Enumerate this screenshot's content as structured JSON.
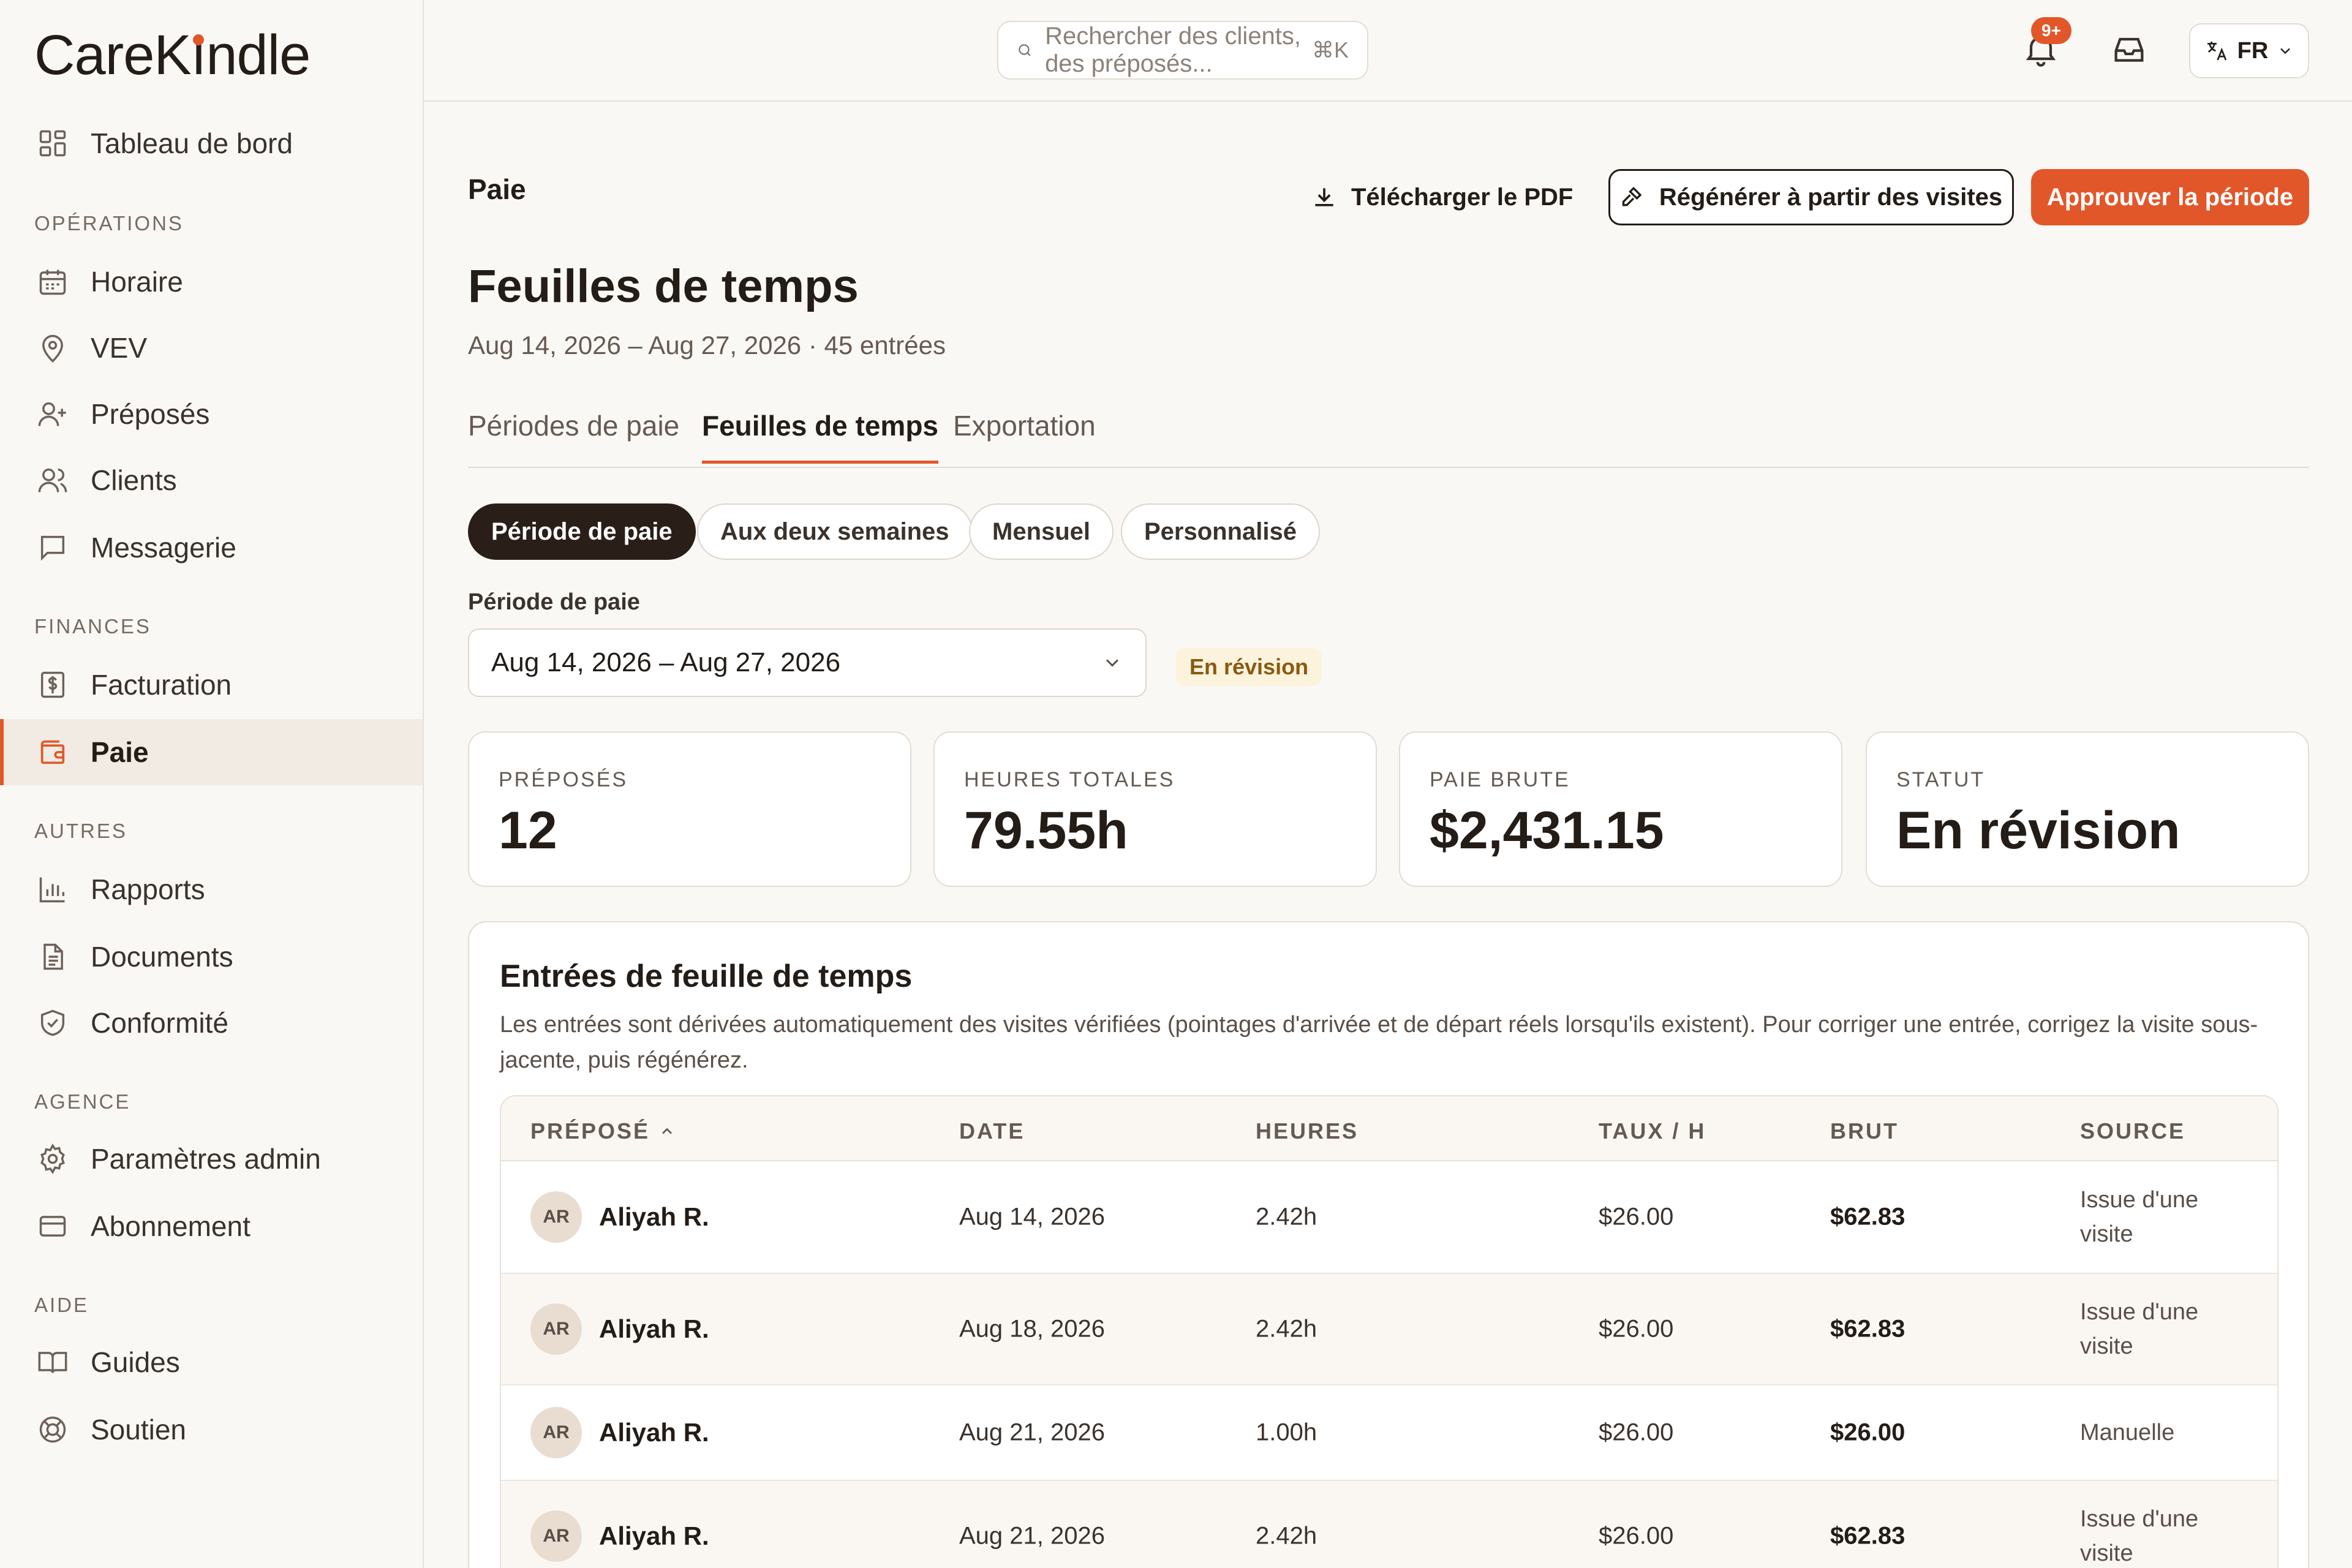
{
  "app": {
    "logo_text_before": "CareK",
    "logo_text_i": "ı",
    "logo_text_after": "ndle",
    "accent_color": "#e2572a"
  },
  "sidebar": {
    "dashboard": "Tableau de bord",
    "sections": {
      "operations": "OPÉRATIONS",
      "finances": "FINANCES",
      "autres": "AUTRES",
      "agence": "AGENCE",
      "aide": "AIDE"
    },
    "items": {
      "horaire": "Horaire",
      "vev": "VEV",
      "preposes": "Préposés",
      "clients": "Clients",
      "messagerie": "Messagerie",
      "facturation": "Facturation",
      "paie": "Paie",
      "rapports": "Rapports",
      "documents": "Documents",
      "conformite": "Conformité",
      "parametres": "Paramètres admin",
      "abonnement": "Abonnement",
      "guides": "Guides",
      "soutien": "Soutien"
    }
  },
  "topbar": {
    "search_placeholder": "Rechercher des clients, des préposés...",
    "search_shortcut": "⌘K",
    "notification_count": "9+",
    "language": "FR"
  },
  "header": {
    "breadcrumb": "Paie",
    "download_label": "Télécharger le PDF",
    "regenerate_label": "Régénérer à partir des visites",
    "approve_label": "Approuver la période",
    "title": "Feuilles de temps",
    "subtitle": "Aug 14, 2026 – Aug 27, 2026 · 45 entrées"
  },
  "tabs": [
    "Périodes de paie",
    "Feuilles de temps",
    "Exportation"
  ],
  "filters": [
    "Période de paie",
    "Aux deux semaines",
    "Mensuel",
    "Personnalisé"
  ],
  "period": {
    "label": "Période de paie",
    "value": "Aug 14, 2026 – Aug 27, 2026",
    "status": "En révision"
  },
  "stats": [
    {
      "label": "PRÉPOSÉS",
      "value": "12"
    },
    {
      "label": "HEURES TOTALES",
      "value": "79.55h"
    },
    {
      "label": "PAIE BRUTE",
      "value": "$2,431.15"
    },
    {
      "label": "STATUT",
      "value": "En révision"
    }
  ],
  "entries": {
    "title": "Entrées de feuille de temps",
    "description": "Les entrées sont dérivées automatiquement des visites vérifiées (pointages d'arrivée et de départ réels lorsqu'ils existent). Pour corriger une entrée, corrigez la visite sous-jacente, puis régénérez.",
    "columns": [
      "PRÉPOSÉ",
      "DATE",
      "HEURES",
      "TAUX / H",
      "BRUT",
      "SOURCE"
    ],
    "rows": [
      {
        "initials": "AR",
        "name": "Aliyah R.",
        "date": "Aug 14, 2026",
        "hours": "2.42h",
        "rate": "$26.00",
        "gross": "$62.83",
        "source": "Issue d'une visite"
      },
      {
        "initials": "AR",
        "name": "Aliyah R.",
        "date": "Aug 18, 2026",
        "hours": "2.42h",
        "rate": "$26.00",
        "gross": "$62.83",
        "source": "Issue d'une visite"
      },
      {
        "initials": "AR",
        "name": "Aliyah R.",
        "date": "Aug 21, 2026",
        "hours": "1.00h",
        "rate": "$26.00",
        "gross": "$26.00",
        "source": "Manuelle"
      },
      {
        "initials": "AR",
        "name": "Aliyah R.",
        "date": "Aug 21, 2026",
        "hours": "2.42h",
        "rate": "$26.00",
        "gross": "$62.83",
        "source": "Issue d'une visite"
      }
    ]
  }
}
